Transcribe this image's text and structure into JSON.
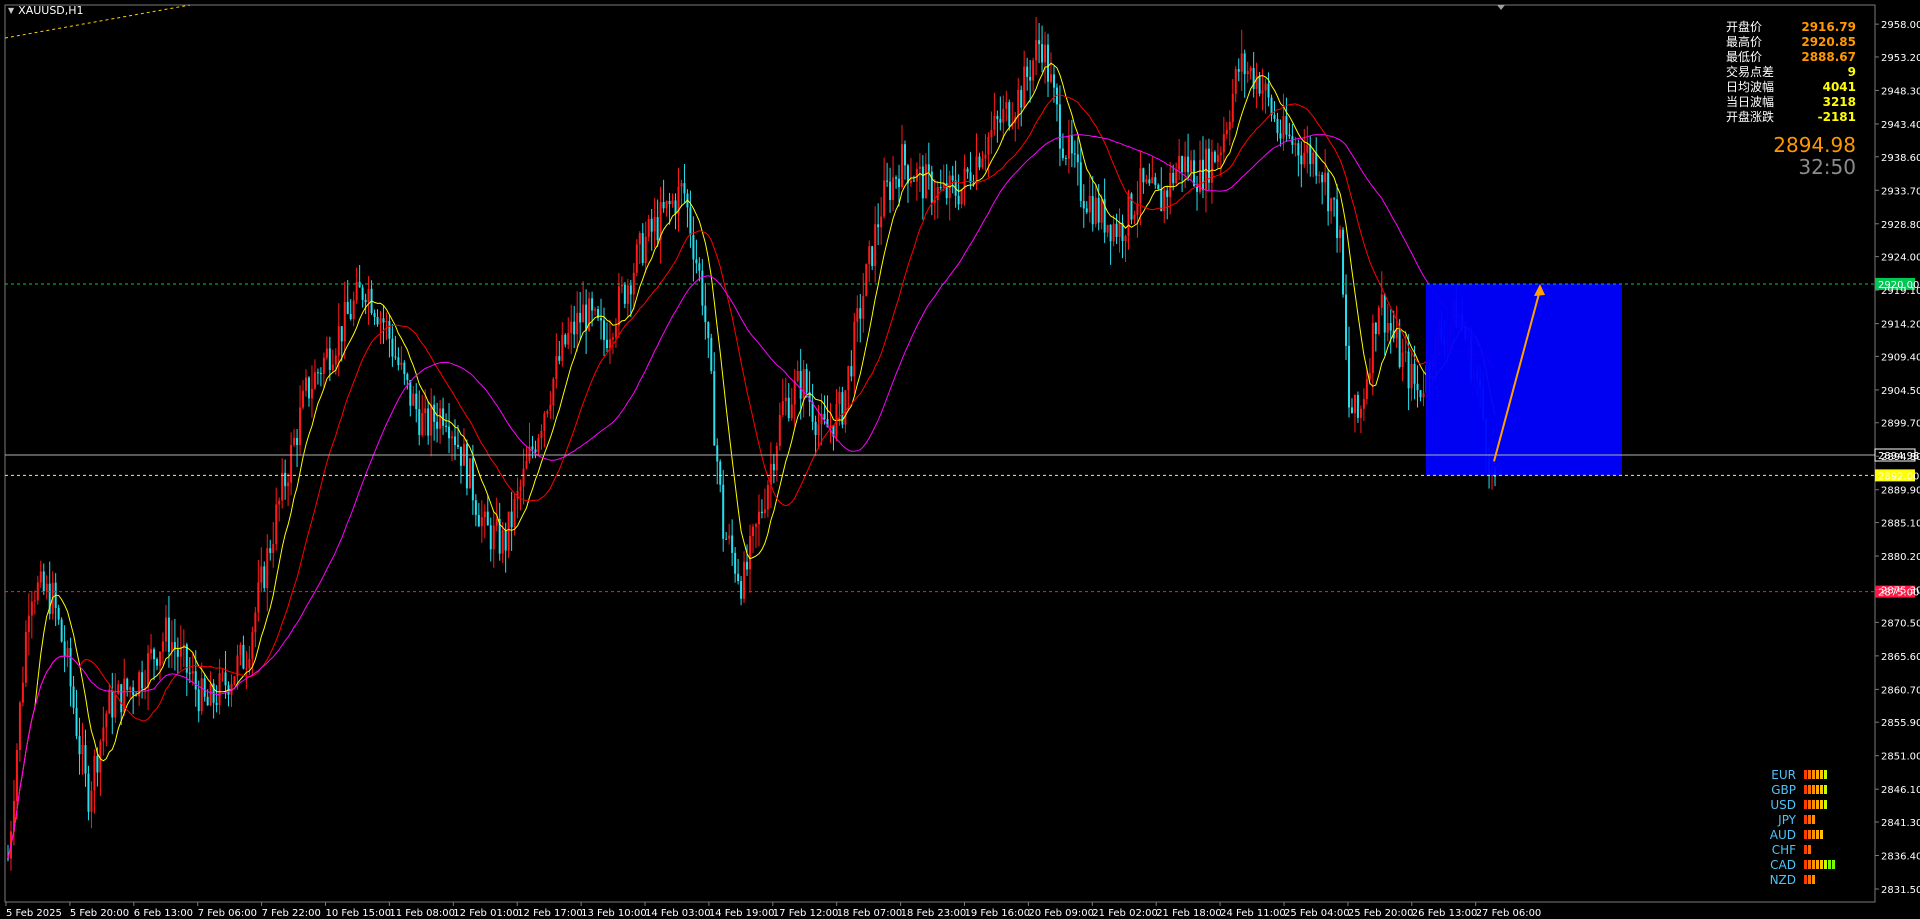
{
  "window": {
    "symbol": "XAUUSD,H1"
  },
  "info_panel": [
    {
      "label": "开盘价",
      "value": "2916.79",
      "color": "#ff9800"
    },
    {
      "label": "最高价",
      "value": "2920.85",
      "color": "#ff9800"
    },
    {
      "label": "最低价",
      "value": "2888.67",
      "color": "#ff9800"
    },
    {
      "label": "交易点差",
      "value": "9",
      "color": "#ffff00"
    },
    {
      "label": "日均波幅",
      "value": "4041",
      "color": "#ffff00"
    },
    {
      "label": "当日波幅",
      "value": "3218",
      "color": "#ffff00"
    },
    {
      "label": "开盘涨跌",
      "value": "-2181",
      "color": "#ffff00"
    }
  ],
  "current_price": "2894.98",
  "bar_timer": "32:50",
  "price_axis": {
    "ticks": [
      "2958.00",
      "2953.20",
      "2948.30",
      "2943.40",
      "2938.60",
      "2933.70",
      "2928.80",
      "2924.00",
      "2919.10",
      "2914.20",
      "2909.40",
      "2904.50",
      "2899.70",
      "2894.80",
      "2889.90",
      "2885.10",
      "2880.20",
      "2875.30",
      "2870.50",
      "2865.60",
      "2860.70",
      "2855.90",
      "2851.00",
      "2846.10",
      "2841.30",
      "2836.40",
      "2831.50"
    ],
    "max": 2960.8,
    "min": 2829.6
  },
  "time_axis": {
    "labels": [
      "5 Feb 2025",
      "5 Feb 20:00",
      "6 Feb 13:00",
      "7 Feb 06:00",
      "7 Feb 22:00",
      "10 Feb 15:00",
      "11 Feb 08:00",
      "12 Feb 01:00",
      "12 Feb 17:00",
      "13 Feb 10:00",
      "14 Feb 03:00",
      "14 Feb 19:00",
      "17 Feb 12:00",
      "18 Feb 07:00",
      "18 Feb 23:00",
      "19 Feb 16:00",
      "20 Feb 09:00",
      "21 Feb 02:00",
      "21 Feb 18:00",
      "24 Feb 11:00",
      "25 Feb 04:00",
      "25 Feb 20:00",
      "26 Feb 13:00",
      "27 Feb 06:00"
    ]
  },
  "levels": [
    {
      "name": "resistance",
      "price": 2920.0,
      "label": "2920.00",
      "color": "#00c853"
    },
    {
      "name": "current",
      "price": 2894.98,
      "label": "2894.98",
      "color": "#b0b0b0"
    },
    {
      "name": "support",
      "price": 2892.0,
      "label": "2892.00",
      "color": "#ffff00"
    },
    {
      "name": "stop",
      "price": 2875.0,
      "label": "2875.00",
      "color": "#ff1744"
    }
  ],
  "zone": {
    "from_price": 2920.0,
    "to_price": 2892.0,
    "color": "#0000ff"
  },
  "arrow": {
    "from_price": 2892.0,
    "to_price": 2920.0,
    "color": "#ffa000"
  },
  "currency_strength": [
    {
      "currency": "EUR",
      "level": 6
    },
    {
      "currency": "GBP",
      "level": 6
    },
    {
      "currency": "USD",
      "level": 6
    },
    {
      "currency": "JPY",
      "level": 3
    },
    {
      "currency": "AUD",
      "level": 5
    },
    {
      "currency": "CHF",
      "level": 2
    },
    {
      "currency": "CAD",
      "level": 8
    },
    {
      "currency": "NZD",
      "level": 3
    }
  ],
  "colors": {
    "bull": "#ff1a1a",
    "bear": "#26e0f0",
    "ma_fast": "#ffff00",
    "ma_mid": "#ff0000",
    "ma_slow": "#ff00ff",
    "grid": "#000000"
  }
}
